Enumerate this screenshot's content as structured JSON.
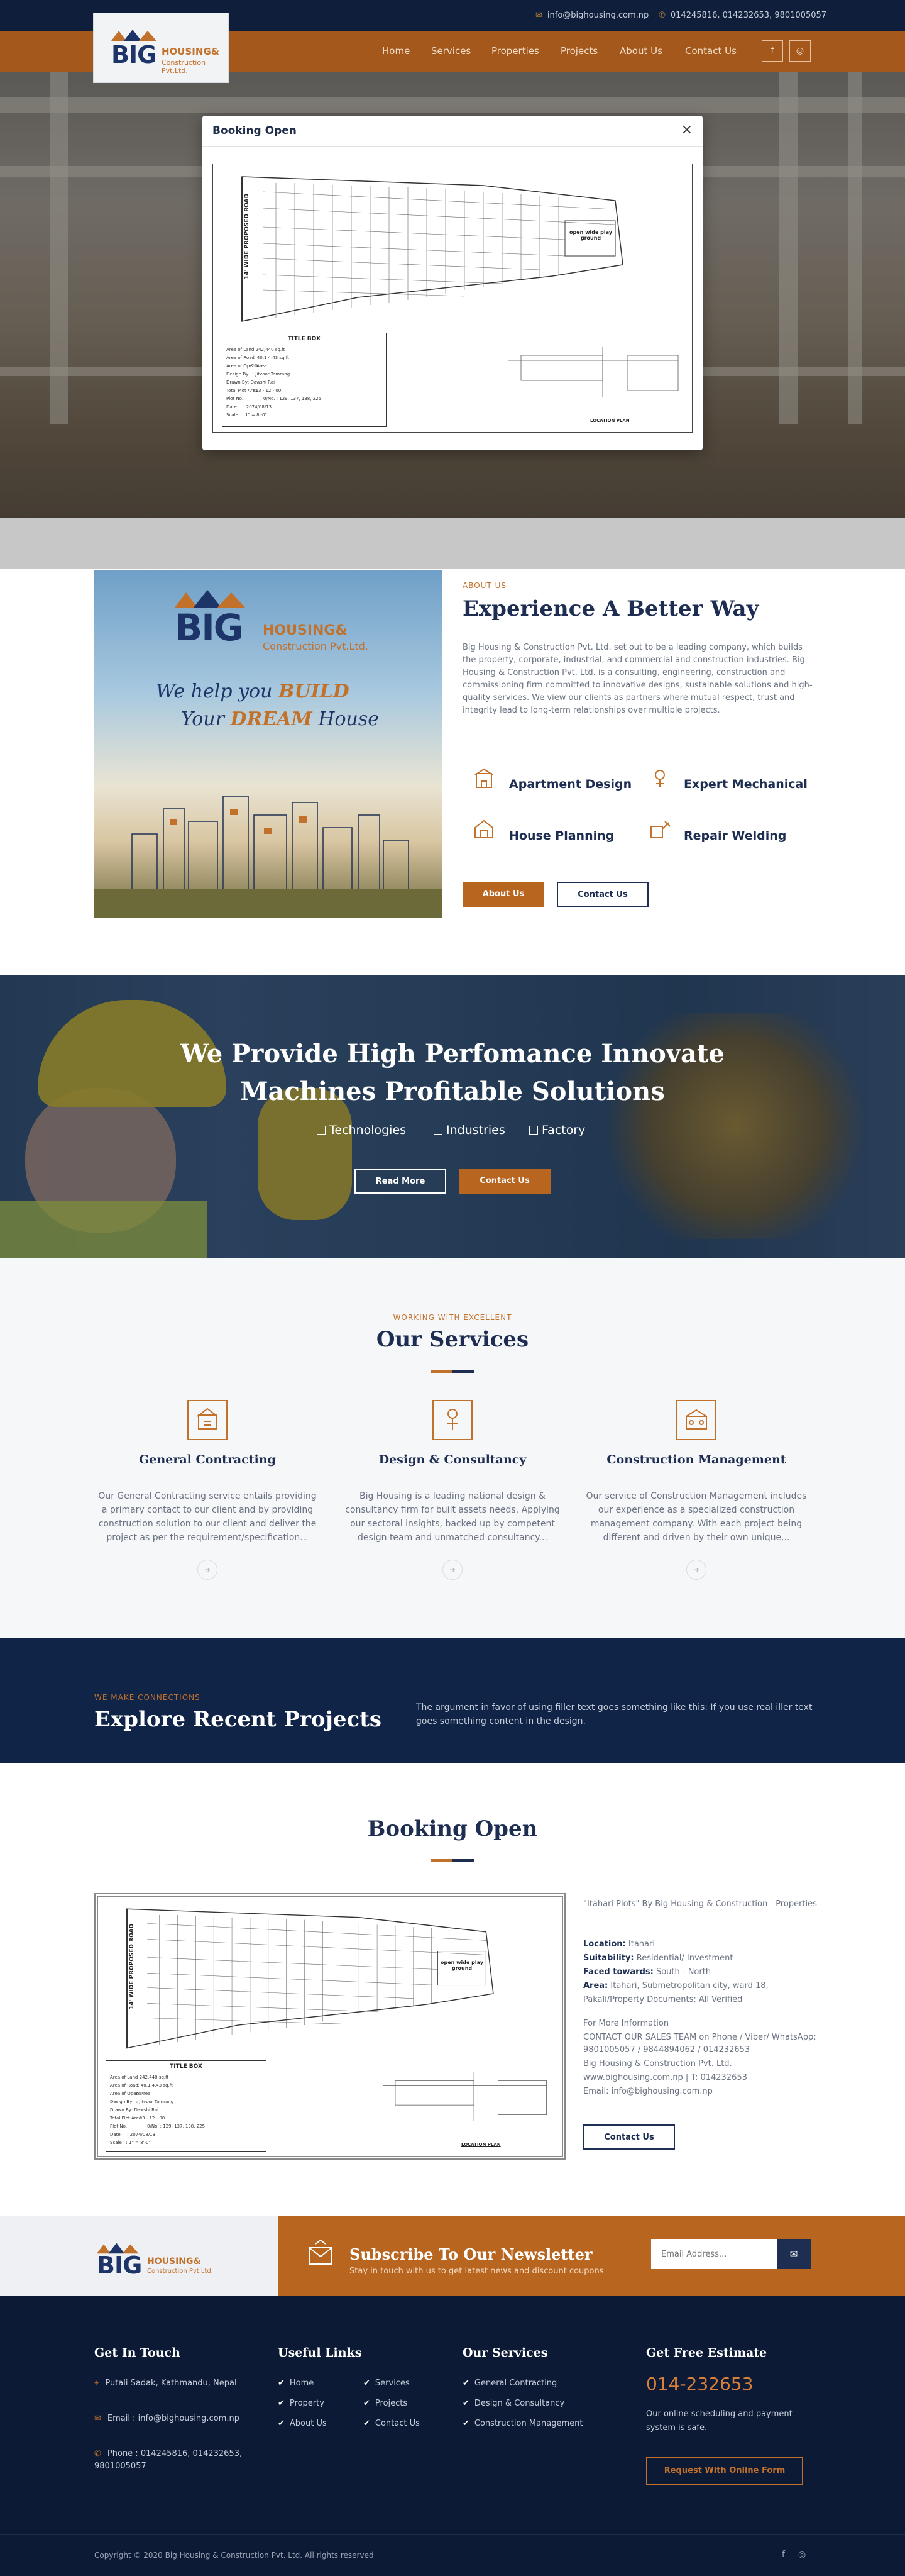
{
  "topbar": {
    "email": "info@bighousing.com.np",
    "phone": "014245816, 014232653, 9801005057"
  },
  "logo": {
    "big": "BIG",
    "housing": "HOUSING&",
    "company": "Construction Pvt.Ltd."
  },
  "nav": {
    "items": [
      {
        "label": "Home"
      },
      {
        "label": "Services"
      },
      {
        "label": "Properties"
      },
      {
        "label": "Projects"
      },
      {
        "label": "About Us"
      },
      {
        "label": "Contact Us"
      }
    ],
    "social": [
      {
        "icon": "facebook-icon",
        "glyph": "f"
      },
      {
        "icon": "instagram-icon",
        "glyph": "◎"
      }
    ]
  },
  "modal": {
    "title": "Booking Open",
    "close": "×"
  },
  "plan": {
    "road_label": "14' WIDE PROPOSED ROAD",
    "open_space": "open wide play ground",
    "title_box": "TITLE BOX",
    "rows": [
      {
        "k": "Area of Land",
        "v": "242,440 sq.ft"
      },
      {
        "k": "Area of Road",
        "v": "40,1 4.43 sq.ft"
      },
      {
        "k": "Area of Open Area",
        "v": "2%"
      },
      {
        "k": "Design By",
        "v": "Jitvoor Tamrang"
      },
      {
        "k": "Drawn By",
        "v": "Dawshi Rai"
      },
      {
        "k": "Total Plot Area",
        "v": "03 - 12 - 00"
      },
      {
        "k": "Plot No.",
        "v": "0/No. : 129, 137, 138, 225"
      },
      {
        "k": "Date",
        "v": "2074/08/13"
      },
      {
        "k": "Scale",
        "v": "1\" = 8'-0\""
      }
    ],
    "location": "LOCATION PLAN"
  },
  "about": {
    "subtitle": "ABOUT US",
    "title": "Experience A Better Way",
    "text": "Big Housing & Construction Pvt. Ltd. set out to be a leading company, which builds the property, corporate, industrial, and commercial and construction industries. Big Housing & Construction Pvt. Ltd. is a consulting, engineering, construction and commissioning firm committed to innovative designs, sustainable solutions and high-quality services. We view our clients as partners where mutual respect, trust and integrity lead to long-term relationships over multiple projects.",
    "image": {
      "big": "BIG",
      "housing": "HOUSING&",
      "company": "Construction Pvt.Ltd.",
      "tag_a": "We help you ",
      "tag_a_em": "BUILD",
      "tag_b": "Your ",
      "tag_b_em": "DREAM",
      "tag_b_end": " House"
    },
    "features": [
      {
        "label": "Apartment Design",
        "icon": "apartment-icon"
      },
      {
        "label": "Expert Mechanical",
        "icon": "mechanical-icon"
      },
      {
        "label": "House Planning",
        "icon": "house-plan-icon"
      },
      {
        "label": "Repair Welding",
        "icon": "welding-icon"
      }
    ],
    "btn_about": "About Us",
    "btn_contact": "Contact Us"
  },
  "machines": {
    "title": "We Provide High Perfomance Innovate Machines Profitable Solutions",
    "tags": [
      "Technologies",
      "Industries",
      "Factory"
    ],
    "btn_read": "Read More",
    "btn_contact": "Contact Us"
  },
  "services": {
    "subtitle": "WORKING WITH EXCELLENT",
    "title": "Our Services",
    "items": [
      {
        "name": "General Contracting",
        "icon": "contracting-icon",
        "desc": "Our General Contracting service entails providing a primary contact to our client and by providing construction solution to our client and deliver the project as per the requirement/specification..."
      },
      {
        "name": "Design & Consultancy",
        "icon": "consultancy-icon",
        "desc": "Big Housing is a leading national design & consultancy firm for built assets needs. Applying our sectoral insights, backed up by competent design team and unmatched consultancy..."
      },
      {
        "name": "Construction Management",
        "icon": "management-icon",
        "desc": "Our service of Construction Management includes our experience as a specialized construction management company. With each project being different and driven by their own unique..."
      }
    ]
  },
  "projects": {
    "subtitle": "WE MAKE CONNECTIONS",
    "title": "Explore Recent Projects",
    "text": "The argument in favor of using filler text goes something like this: If you use real iller text goes something content in the design."
  },
  "booking": {
    "title": "Booking Open",
    "intro": "\"Itahari Plots\" By Big Housing & Construction - Properties",
    "location_label": "Location:",
    "location": " Itahari",
    "suitability_label": "Suitability:",
    "suitability": " Residential/ Investment",
    "faced_label": "Faced towards:",
    "faced": " South - North",
    "area_label": "Area:",
    "area": " Itahari, Submetropolitan city, ward 18,",
    "docs": "Pakali/Property Documents: All Verified",
    "more": "For More Information",
    "contact": "CONTACT OUR SALES TEAM on Phone / Viber/ WhatsApp: 9801005057 / 9844894062 / 014232653",
    "company": "Big Housing & Construction Pvt. Ltd.",
    "web": "www.bighousing.com.np | T: 014232653",
    "email": "Email: info@bighousing.com.np",
    "btn": "Contact Us"
  },
  "newsletter": {
    "title": "Subscribe To Our Newsletter",
    "sub": "Stay in touch with us to get latest news and discount coupons",
    "placeholder": "Email Address..."
  },
  "footer": {
    "touch": {
      "title": "Get In Touch",
      "address": "Putali Sadak, Kathmandu, Nepal",
      "email": "Email : info@bighousing.com.np",
      "phone": "Phone : 014245816, 014232653, 9801005057"
    },
    "useful": {
      "title": "Useful Links",
      "col1": [
        "Home",
        "Property",
        "About Us"
      ],
      "col2": [
        "Services",
        "Projects",
        "Contact Us"
      ]
    },
    "services": {
      "title": "Our Services",
      "items": [
        "General Contracting",
        "Design & Consultancy",
        "Construction Management"
      ]
    },
    "estimate": {
      "title": "Get Free Estimate",
      "phone": "014-232653",
      "text": "Our online scheduling and payment system is safe.",
      "btn": "Request With Online Form"
    },
    "copyright": "Copyright © 2020 Big Housing & Construction Pvt. Ltd. All rights reserved",
    "social": [
      {
        "icon": "facebook-icon",
        "glyph": "f"
      },
      {
        "icon": "instagram-icon",
        "glyph": "◎"
      }
    ]
  },
  "colors": {
    "navy": "#1d2e52",
    "orange": "#c2712b",
    "nav_brown": "#a4581c",
    "footer": "#0c1a35"
  }
}
